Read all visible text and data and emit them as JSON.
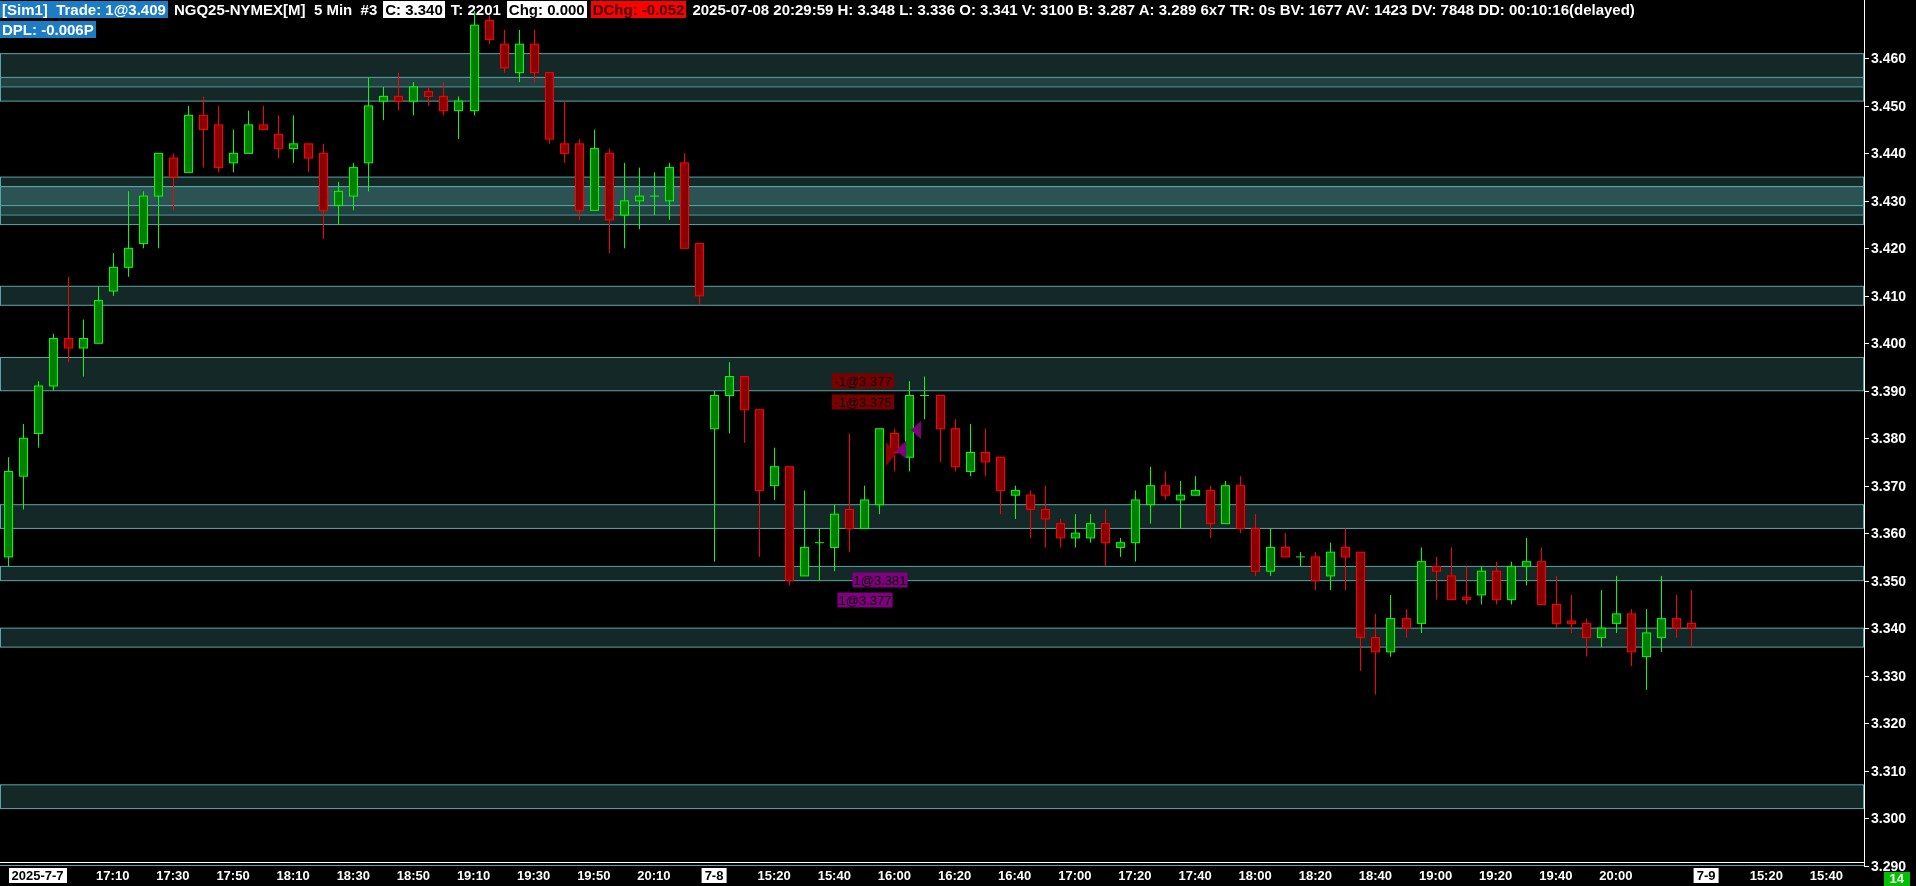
{
  "header": {
    "lines": [
      [
        {
          "text": "[Sim1]  Trade: 1@3.409",
          "kind": "account"
        },
        {
          "text": "NGQ25-NYMEX[M]  5 Min  #3",
          "kind": "plain"
        },
        {
          "text": "C: 3.340",
          "kind": "inverse"
        },
        {
          "text": "T: 2201",
          "kind": "plain"
        },
        {
          "text": "Chg: 0.000",
          "kind": "inverse"
        },
        {
          "text": "DChg: -0.052",
          "kind": "negative"
        },
        {
          "text": "2025-07-08 20:29:59 H: 3.348 L: 3.336 O: 3.341 V: 3100 B: 3.287 A: 3.289 6x7 TR: 0s BV: 1677 AV: 1423 DV: 7848 DD: 00:10:16(delayed)",
          "kind": "plain"
        }
      ],
      [
        {
          "text": "DPL: -0.006P",
          "kind": "account"
        }
      ]
    ]
  },
  "chart": {
    "bar_timer": "14",
    "xtick_boxes": [
      {
        "boxed": true
      },
      {
        "boxed": false
      },
      {
        "boxed": false
      },
      {
        "boxed": false
      },
      {
        "boxed": false
      },
      {
        "boxed": false
      },
      {
        "boxed": false
      },
      {
        "boxed": false
      },
      {
        "boxed": false
      },
      {
        "boxed": false
      },
      {
        "boxed": false
      },
      {
        "boxed": true
      },
      {
        "boxed": false
      },
      {
        "boxed": false
      },
      {
        "boxed": false
      },
      {
        "boxed": false
      },
      {
        "boxed": false
      },
      {
        "boxed": false
      },
      {
        "boxed": false
      },
      {
        "boxed": false
      },
      {
        "boxed": false
      },
      {
        "boxed": false
      },
      {
        "boxed": false
      },
      {
        "boxed": false
      },
      {
        "boxed": false
      },
      {
        "boxed": false
      },
      {
        "boxed": false
      },
      {
        "boxed": true
      },
      {
        "boxed": false
      },
      {
        "boxed": false
      }
    ],
    "chart_data": {
      "type": "candlestick",
      "ylim": [
        3.2899,
        3.4723
      ],
      "categories": [
        null,
        null,
        "2025-7-7",
        null,
        null,
        null,
        null,
        "17:10",
        null,
        null,
        null,
        "17:30",
        null,
        null,
        null,
        "17:50",
        null,
        null,
        null,
        "18:10",
        null,
        null,
        null,
        "18:30",
        null,
        null,
        null,
        "18:50",
        null,
        null,
        null,
        "19:10",
        null,
        null,
        null,
        "19:30",
        null,
        null,
        null,
        "19:50",
        null,
        null,
        null,
        "20:10",
        null,
        null,
        null,
        "7-8",
        null,
        null,
        null,
        "15:20",
        null,
        null,
        null,
        "15:40",
        null,
        null,
        null,
        "16:00",
        null,
        null,
        null,
        "16:20",
        null,
        null,
        null,
        "16:40",
        null,
        null,
        null,
        "17:00",
        null,
        null,
        null,
        "17:20",
        null,
        null,
        null,
        "17:40",
        null,
        null,
        null,
        "18:00",
        null,
        null,
        null,
        "18:20",
        null,
        null,
        null,
        "18:40",
        null,
        null,
        null,
        "19:00",
        null,
        null,
        null,
        "19:20",
        null,
        null,
        null,
        "19:40",
        null,
        null,
        null,
        "20:00",
        null,
        null,
        null,
        null,
        null,
        "7-9",
        null,
        null,
        null,
        "15:20",
        null,
        null,
        null,
        "15:40",
        null,
        null
      ],
      "yticks": [
        {
          "value": 3.46,
          "label": "3.460"
        },
        {
          "value": 3.45,
          "label": "3.450"
        },
        {
          "value": 3.44,
          "label": "3.440"
        },
        {
          "value": 3.43,
          "label": "3.430"
        },
        {
          "value": 3.42,
          "label": "3.420"
        },
        {
          "value": 3.41,
          "label": "3.410"
        },
        {
          "value": 3.4,
          "label": "3.400"
        },
        {
          "value": 3.39,
          "label": "3.390"
        },
        {
          "value": 3.38,
          "label": "3.380"
        },
        {
          "value": 3.37,
          "label": "3.370"
        },
        {
          "value": 3.36,
          "label": "3.360"
        },
        {
          "value": 3.35,
          "label": "3.350"
        },
        {
          "value": 3.34,
          "label": "3.340"
        },
        {
          "value": 3.33,
          "label": "3.330"
        },
        {
          "value": 3.32,
          "label": "3.320"
        },
        {
          "value": 3.31,
          "label": "3.310"
        },
        {
          "value": 3.3,
          "label": "3.300"
        },
        {
          "value": 3.29,
          "label": "3.290"
        }
      ],
      "ohlc": [
        [
          3.355,
          3.376,
          3.353,
          3.373
        ],
        [
          3.372,
          3.383,
          3.365,
          3.38
        ],
        [
          3.381,
          3.392,
          3.378,
          3.391
        ],
        [
          3.391,
          3.402,
          3.39,
          3.401
        ],
        [
          3.401,
          3.414,
          3.396,
          3.399
        ],
        [
          3.399,
          3.405,
          3.393,
          3.401
        ],
        [
          3.4,
          3.412,
          3.4,
          3.409
        ],
        [
          3.411,
          3.419,
          3.41,
          3.416
        ],
        [
          3.416,
          3.432,
          3.414,
          3.42
        ],
        [
          3.421,
          3.432,
          3.42,
          3.431
        ],
        [
          3.431,
          3.44,
          3.42,
          3.44
        ],
        [
          3.439,
          3.44,
          3.428,
          3.435
        ],
        [
          3.436,
          3.45,
          3.436,
          3.448
        ],
        [
          3.448,
          3.452,
          3.437,
          3.445
        ],
        [
          3.446,
          3.45,
          3.436,
          3.437
        ],
        [
          3.438,
          3.445,
          3.436,
          3.44
        ],
        [
          3.44,
          3.449,
          3.44,
          3.446
        ],
        [
          3.446,
          3.45,
          3.445,
          3.445
        ],
        [
          3.444,
          3.448,
          3.439,
          3.441
        ],
        [
          3.441,
          3.448,
          3.438,
          3.442
        ],
        [
          3.442,
          3.442,
          3.436,
          3.439
        ],
        [
          3.44,
          3.442,
          3.422,
          3.428
        ],
        [
          3.429,
          3.434,
          3.425,
          3.432
        ],
        [
          3.431,
          3.438,
          3.428,
          3.437
        ],
        [
          3.438,
          3.456,
          3.432,
          3.45
        ],
        [
          3.451,
          3.454,
          3.447,
          3.452
        ],
        [
          3.452,
          3.457,
          3.449,
          3.451
        ],
        [
          3.451,
          3.455,
          3.448,
          3.454
        ],
        [
          3.453,
          3.454,
          3.45,
          3.452
        ],
        [
          3.452,
          3.455,
          3.448,
          3.449
        ],
        [
          3.449,
          3.452,
          3.443,
          3.451
        ],
        [
          3.449,
          3.47,
          3.448,
          3.467
        ],
        [
          3.468,
          3.469,
          3.463,
          3.464
        ],
        [
          3.463,
          3.466,
          3.457,
          3.458
        ],
        [
          3.457,
          3.466,
          3.455,
          3.463
        ],
        [
          3.463,
          3.466,
          3.455,
          3.457
        ],
        [
          3.457,
          3.457,
          3.442,
          3.443
        ],
        [
          3.442,
          3.451,
          3.438,
          3.44
        ],
        [
          3.442,
          3.443,
          3.426,
          3.428
        ],
        [
          3.428,
          3.445,
          3.428,
          3.441
        ],
        [
          3.44,
          3.441,
          3.419,
          3.426
        ],
        [
          3.427,
          3.438,
          3.42,
          3.43
        ],
        [
          3.43,
          3.437,
          3.424,
          3.431
        ],
        [
          3.431,
          3.436,
          3.427,
          3.431
        ],
        [
          3.43,
          3.438,
          3.426,
          3.437
        ],
        [
          3.438,
          3.44,
          3.42,
          3.42
        ],
        [
          3.421,
          3.421,
          3.408,
          3.41
        ],
        [
          3.382,
          3.39,
          3.354,
          3.389
        ],
        [
          3.389,
          3.396,
          3.381,
          3.393
        ],
        [
          3.393,
          3.393,
          3.379,
          3.386
        ],
        [
          3.386,
          3.386,
          3.355,
          3.369
        ],
        [
          3.37,
          3.378,
          3.367,
          3.374
        ],
        [
          3.374,
          3.374,
          3.349,
          3.35
        ],
        [
          3.351,
          3.369,
          3.351,
          3.357
        ],
        [
          3.358,
          3.361,
          3.35,
          3.358
        ],
        [
          3.357,
          3.366,
          3.352,
          3.364
        ],
        [
          3.365,
          3.381,
          3.356,
          3.361
        ],
        [
          3.361,
          3.37,
          3.361,
          3.367
        ],
        [
          3.366,
          3.382,
          3.364,
          3.382
        ],
        [
          3.381,
          3.382,
          3.373,
          3.377
        ],
        [
          3.376,
          3.392,
          3.373,
          3.389
        ],
        [
          3.389,
          3.393,
          3.384,
          3.389
        ],
        [
          3.389,
          3.389,
          3.375,
          3.382
        ],
        [
          3.382,
          3.384,
          3.373,
          3.374
        ],
        [
          3.373,
          3.383,
          3.372,
          3.377
        ],
        [
          3.377,
          3.382,
          3.372,
          3.375
        ],
        [
          3.376,
          3.376,
          3.364,
          3.369
        ],
        [
          3.368,
          3.37,
          3.363,
          3.369
        ],
        [
          3.368,
          3.369,
          3.359,
          3.365
        ],
        [
          3.365,
          3.37,
          3.357,
          3.363
        ],
        [
          3.362,
          3.363,
          3.357,
          3.359
        ],
        [
          3.359,
          3.364,
          3.357,
          3.36
        ],
        [
          3.359,
          3.364,
          3.358,
          3.362
        ],
        [
          3.362,
          3.365,
          3.353,
          3.358
        ],
        [
          3.357,
          3.359,
          3.355,
          3.358
        ],
        [
          3.358,
          3.369,
          3.354,
          3.367
        ],
        [
          3.366,
          3.374,
          3.362,
          3.37
        ],
        [
          3.37,
          3.373,
          3.367,
          3.368
        ],
        [
          3.367,
          3.371,
          3.361,
          3.368
        ],
        [
          3.368,
          3.372,
          3.368,
          3.369
        ],
        [
          3.369,
          3.37,
          3.359,
          3.362
        ],
        [
          3.362,
          3.371,
          3.362,
          3.37
        ],
        [
          3.37,
          3.372,
          3.36,
          3.361
        ],
        [
          3.361,
          3.364,
          3.351,
          3.352
        ],
        [
          3.352,
          3.361,
          3.351,
          3.357
        ],
        [
          3.357,
          3.36,
          3.355,
          3.355
        ],
        [
          3.355,
          3.356,
          3.353,
          3.355
        ],
        [
          3.355,
          3.356,
          3.348,
          3.35
        ],
        [
          3.351,
          3.358,
          3.348,
          3.356
        ],
        [
          3.357,
          3.361,
          3.348,
          3.355
        ],
        [
          3.356,
          3.356,
          3.331,
          3.338
        ],
        [
          3.338,
          3.343,
          3.326,
          3.335
        ],
        [
          3.335,
          3.347,
          3.334,
          3.342
        ],
        [
          3.342,
          3.344,
          3.338,
          3.34
        ],
        [
          3.341,
          3.357,
          3.339,
          3.354
        ],
        [
          3.353,
          3.355,
          3.346,
          3.352
        ],
        [
          3.351,
          3.357,
          3.346,
          3.346
        ],
        [
          3.3465,
          3.353,
          3.345,
          3.346
        ],
        [
          3.347,
          3.353,
          3.345,
          3.352
        ],
        [
          3.352,
          3.354,
          3.345,
          3.346
        ],
        [
          3.346,
          3.354,
          3.345,
          3.353
        ],
        [
          3.353,
          3.359,
          3.349,
          3.354
        ],
        [
          3.354,
          3.357,
          3.345,
          3.345
        ],
        [
          3.345,
          3.351,
          3.34,
          3.341
        ],
        [
          3.3415,
          3.347,
          3.339,
          3.341
        ],
        [
          3.341,
          3.342,
          3.334,
          3.338
        ],
        [
          3.338,
          3.348,
          3.336,
          3.34
        ],
        [
          3.341,
          3.351,
          3.339,
          3.343
        ],
        [
          3.343,
          3.344,
          3.332,
          3.335
        ],
        [
          3.334,
          3.344,
          3.327,
          3.339
        ],
        [
          3.338,
          3.351,
          3.335,
          3.342
        ],
        [
          3.342,
          3.347,
          3.338,
          3.34
        ],
        [
          3.341,
          3.348,
          3.336,
          3.34
        ],
        null,
        null,
        null,
        null,
        null,
        null,
        null,
        null,
        null,
        null,
        null
      ],
      "bands": [
        {
          "axis": "y",
          "from": 3.454,
          "to": 3.461
        },
        {
          "axis": "y",
          "from": 3.451,
          "to": 3.456
        },
        {
          "axis": "y",
          "from": 3.427,
          "to": 3.435
        },
        {
          "axis": "y",
          "from": 3.425,
          "to": 3.433
        },
        {
          "axis": "y",
          "from": 3.429,
          "to": 3.433
        },
        {
          "axis": "y",
          "from": 3.408,
          "to": 3.412
        },
        {
          "axis": "y",
          "from": 3.39,
          "to": 3.397
        },
        {
          "axis": "y",
          "from": 3.361,
          "to": 3.366
        },
        {
          "axis": "y",
          "from": 3.35,
          "to": 3.353
        },
        {
          "axis": "y",
          "from": 3.336,
          "to": 3.34
        },
        {
          "axis": "y",
          "from": 3.302,
          "to": 3.307
        },
        {
          "axis": "y",
          "from": 3.2875,
          "to": 3.29
        }
      ],
      "annotations": [
        "-1@3.377",
        "-1@3.375",
        "1@3.381",
        "1@3.377"
      ]
    }
  }
}
